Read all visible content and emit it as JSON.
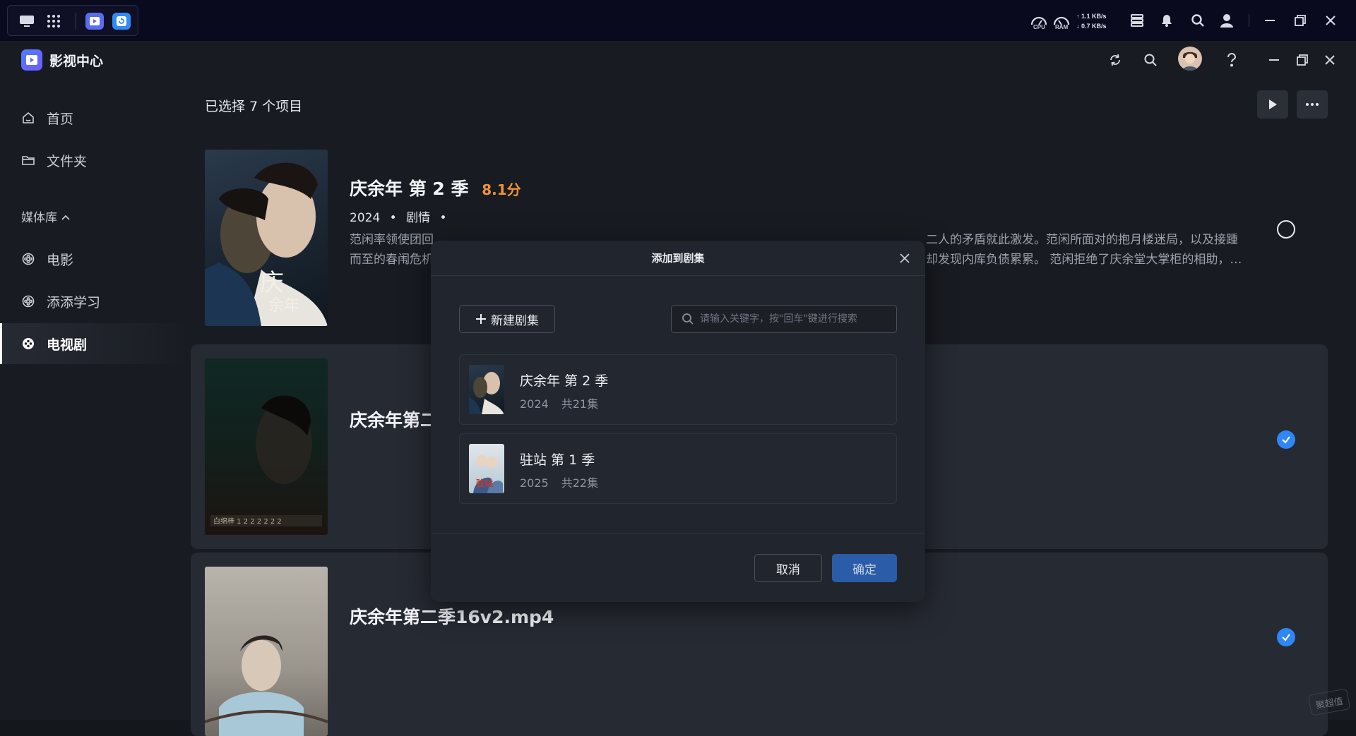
{
  "os": {
    "cpu_label": "CPU",
    "ram_label": "RAM",
    "net_up": "1.1 KB/s",
    "net_down": "0.7 KB/s"
  },
  "app": {
    "name": "影视中心"
  },
  "sidebar": {
    "items": [
      {
        "label": "首页",
        "icon": "home-icon"
      },
      {
        "label": "文件夹",
        "icon": "folder-icon"
      }
    ],
    "section": "媒体库",
    "library": [
      {
        "label": "电影",
        "icon": "film-reel-icon"
      },
      {
        "label": "添添学习",
        "icon": "film-reel-icon"
      },
      {
        "label": "电视剧",
        "icon": "film-reel-icon",
        "active": true
      }
    ]
  },
  "main": {
    "selection_text": "已选择 7 个项目",
    "rows": [
      {
        "title": "庆余年 第 2 季",
        "rating": "8.1分",
        "year": "2024",
        "genre": "剧情",
        "desc_left_1": "范闲率领使团回",
        "desc_right_1": "二人的矛盾就此激发。范闲所面对的抱月楼迷局，以及接踵",
        "desc_left_2": "而至的春闱危机",
        "desc_right_2": "却发现内库负债累累。 范闲拒绝了庆余堂大掌柜的相助，…",
        "selected": false
      },
      {
        "title": "庆余年第二",
        "selected": true
      },
      {
        "title": "庆余年第二季16v2.mp4",
        "selected": true
      }
    ]
  },
  "dialog": {
    "title": "添加到剧集",
    "new_button": "新建剧集",
    "search_placeholder": "请输入关键字，按\"回车\"键进行搜索",
    "series": [
      {
        "name": "庆余年 第 2 季",
        "year": "2024",
        "episodes": "共21集"
      },
      {
        "name": "驻站 第 1 季",
        "year": "2025",
        "episodes": "共22集"
      }
    ],
    "cancel": "取消",
    "confirm": "确定"
  },
  "watermark": "聚超值"
}
